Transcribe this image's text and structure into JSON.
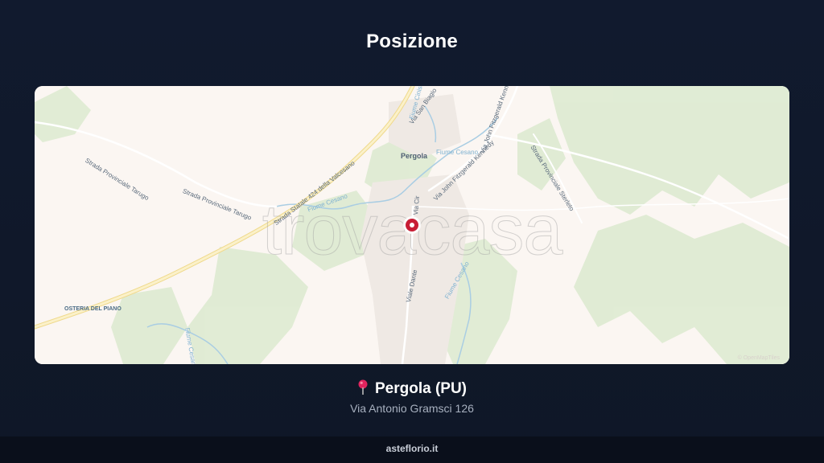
{
  "header": {
    "title": "Posizione"
  },
  "map": {
    "watermark": "trovacasa",
    "attribution": "© OpenMapTiles",
    "labels": {
      "town": "Pergola",
      "osteria": "OSTERIA DEL PIANO",
      "road_sp_tarugo": "Strada Provinciale Tarugo",
      "road_sp_tarugo2": "Strada Provinciale Tarugo",
      "road_ss424": "Strada Statale 424 della Valcesano",
      "road_kennedy": "Via John Fitzgerald Kennedy",
      "road_kennedy2": "Via John Fitzgerald Kennedy",
      "road_sterleto": "Strada Provinciale Sterleto",
      "road_dante": "Viale Dante",
      "road_san_biagio": "Via San Biagio",
      "road_via_cir": "Via Cir",
      "river_cesano": "Fiume Cesano",
      "river_cesano2": "Fiume Cesano",
      "river_cesano3": "Fiume Cesano",
      "river_cinisco": "Fiume Cinisco",
      "river_cesano4": "Fiume Cesano"
    },
    "colors": {
      "land": "#fbf6f2",
      "forest": "#dfebd3",
      "road": "#f3e6b5",
      "water": "#a9cde3",
      "marker": "#c81e35"
    }
  },
  "location": {
    "pin_icon": "map-pin-icon",
    "city": "Pergola (PU)",
    "address": "Via Antonio Gramsci 126"
  },
  "footer": {
    "site": "asteflorio.it"
  }
}
